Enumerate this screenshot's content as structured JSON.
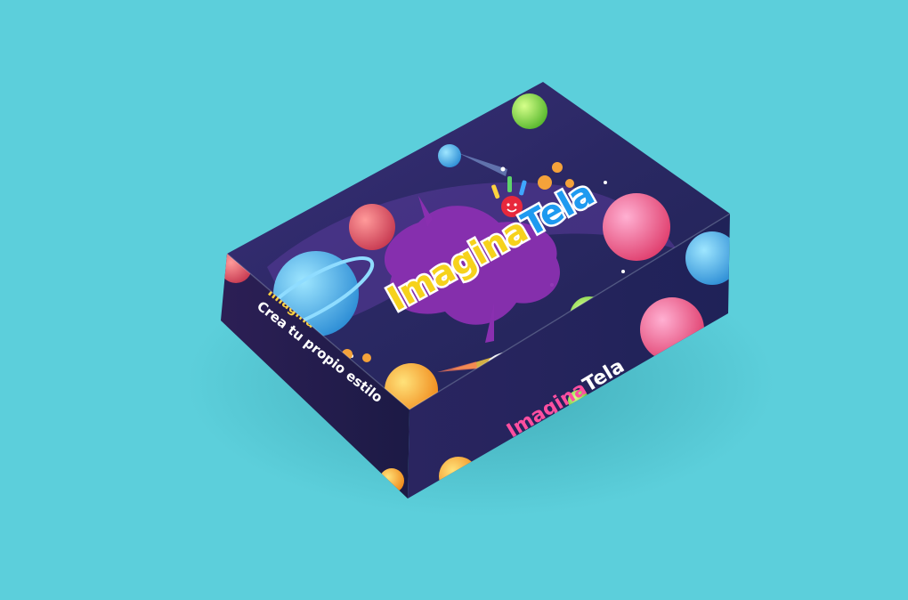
{
  "scene": {
    "background_color": "#5ccfdb",
    "box_top_color": "#2d2a63",
    "box_side_color": "#231f4f"
  },
  "brand": {
    "logo_part1": "Imagina",
    "logo_part2": "Tela",
    "tagline": "Crea tu propio estilo"
  },
  "icons": [
    "planet-icon",
    "rocket-icon",
    "splash-icon",
    "hand-mascot-icon",
    "star-icon"
  ]
}
